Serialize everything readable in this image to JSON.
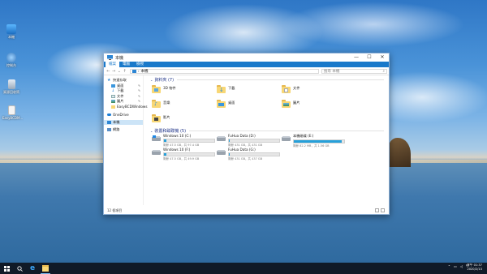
{
  "desktop": {
    "icons": [
      {
        "label": "本機",
        "icon": "pc-icon"
      },
      {
        "label": "控制台",
        "icon": "control-panel-icon"
      },
      {
        "label": "資源回收筒",
        "icon": "recycle-bin-icon"
      },
      {
        "label": "EasyBCDM...",
        "icon": "file-icon"
      }
    ]
  },
  "window": {
    "title": "本機",
    "controls": {
      "minimize": "—",
      "maximize": "☐",
      "close": "✕"
    },
    "ribbon_tabs": [
      "檔案",
      "電腦",
      "檢視"
    ],
    "address": "本機",
    "search_placeholder": "搜尋 本機"
  },
  "sidebar": {
    "items": [
      {
        "label": "快速存取",
        "icon": "star-icon",
        "indent": false,
        "pinned": false
      },
      {
        "label": "桌面",
        "icon": "desktop-folder-icon",
        "indent": true,
        "pinned": true
      },
      {
        "label": "下載",
        "icon": "download-icon",
        "indent": true,
        "pinned": true
      },
      {
        "label": "文件",
        "icon": "document-icon",
        "indent": true,
        "pinned": true
      },
      {
        "label": "圖片",
        "icon": "picture-icon",
        "indent": true,
        "pinned": true
      },
      {
        "label": "EasyBCDWindows",
        "icon": "folder-icon",
        "indent": true,
        "pinned": false
      },
      {
        "label": "OneDrive",
        "icon": "cloud-icon",
        "indent": false,
        "pinned": false
      },
      {
        "label": "本機",
        "icon": "pc-icon",
        "indent": false,
        "pinned": false,
        "selected": true
      },
      {
        "label": "網路",
        "icon": "network-icon",
        "indent": false,
        "pinned": false
      }
    ]
  },
  "folders_section": {
    "title": "資料夾 (7)",
    "items": [
      {
        "name": "3D 物件",
        "icon": "3d-objects-icon"
      },
      {
        "name": "下載",
        "icon": "downloads-folder-icon"
      },
      {
        "name": "文件",
        "icon": "documents-folder-icon"
      },
      {
        "name": "音樂",
        "icon": "music-folder-icon"
      },
      {
        "name": "桌面",
        "icon": "desktop-folder-icon"
      },
      {
        "name": "圖片",
        "icon": "pictures-folder-icon"
      },
      {
        "name": "影片",
        "icon": "videos-folder-icon"
      }
    ]
  },
  "drives_section": {
    "title": "裝置和磁碟機 (5)",
    "drives": [
      {
        "name": "Windows 10 (C:)",
        "free": "剩餘 47.5 GB，共 97.4 GB",
        "used_fraction": 0.05
      },
      {
        "name": "FuHua Data (D:)",
        "free": "剩餘 431 GB，共 431 GB",
        "used_fraction": 0.02
      },
      {
        "name": "本機磁碟 (E:)",
        "free": "剩餘 82.2 MB，共 1.56 GB",
        "used_fraction": 0.95
      },
      {
        "name": "Windows 10 (F:)",
        "free": "剩餘 47.5 GB，共 49.9 GB",
        "used_fraction": 0.05
      },
      {
        "name": "FuHua Data (G:)",
        "free": "剩餘 431 GB，共 437 GB",
        "used_fraction": 0.02
      }
    ]
  },
  "status": {
    "item_count": "12 個項目"
  },
  "taskbar": {
    "items": [
      "windows-start-icon",
      "search-icon",
      "ie-icon",
      "file-explorer-icon"
    ],
    "tray_lang": "中",
    "time": "下午 01:37",
    "date": "2020/2/13"
  }
}
